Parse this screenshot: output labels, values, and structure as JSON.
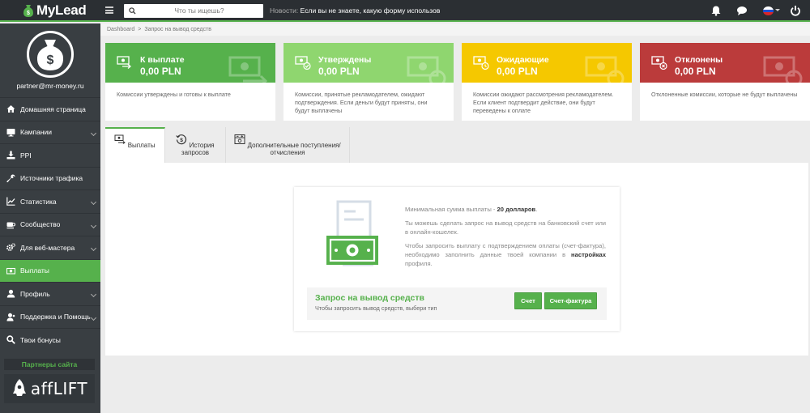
{
  "app": {
    "logo_my": "My",
    "logo_lead": "Lead"
  },
  "topbar": {
    "search_placeholder": "Что ты ищешь?",
    "news_label": "Новости:",
    "news_text": "Если вы не знаете, какую форму использовать при оп"
  },
  "sidebar": {
    "user_email": "partner@mr-money.ru",
    "items": [
      {
        "label": "Домашняя страница",
        "icon": "home-icon",
        "chevron": false
      },
      {
        "label": "Кампании",
        "icon": "monitor-icon",
        "chevron": true
      },
      {
        "label": "PPI",
        "icon": "download-icon",
        "chevron": false
      },
      {
        "label": "Источники трафика",
        "icon": "wrench-icon",
        "chevron": false
      },
      {
        "label": "Статистика",
        "icon": "chart-icon",
        "chevron": true
      },
      {
        "label": "Сообщество",
        "icon": "coffee-icon",
        "chevron": true
      },
      {
        "label": "Для веб-мастера",
        "icon": "gears-icon",
        "chevron": true
      },
      {
        "label": "Выплаты",
        "icon": "money-icon",
        "chevron": false,
        "active": true
      },
      {
        "label": "Профиль",
        "icon": "user-icon",
        "chevron": true
      },
      {
        "label": "Поддержка и Помощь",
        "icon": "user-help-icon",
        "chevron": true
      },
      {
        "label": "Твои бонусы",
        "icon": "search-icon",
        "chevron": false
      }
    ],
    "partners_label": "Партнеры сайта",
    "partner_logo_text": "affLIFT"
  },
  "breadcrumb": {
    "root": "Dashboard",
    "separator": ">",
    "current": "Запрос на вывод средств"
  },
  "cards": [
    {
      "title": "К выплате",
      "amount": "0,00 PLN",
      "desc": "Комиссии утверждены и готовы к выплате",
      "color": "#56b14c"
    },
    {
      "title": "Утверждены",
      "amount": "0,00 PLN",
      "desc": "Комиссии, принятые рекламодателем, ожидают подтверждения. Если деньги будут приняты, они будут выплачены",
      "color": "#8fd66f"
    },
    {
      "title": "Ожидающие",
      "amount": "0,00 PLN",
      "desc": "Комиссии ожидают рассмотрения рекламодателем. Если клиент подтвердит действие, они будут переведены к оплате",
      "color": "#f5c800"
    },
    {
      "title": "Отклонены",
      "amount": "0,00 PLN",
      "desc": "Отклоненные комиссии, которые не будут выплачены",
      "color": "#bb3b3b"
    }
  ],
  "tabs": [
    {
      "label": "Выплаты",
      "icon": "payout-icon",
      "active": true
    },
    {
      "label": "История запросов",
      "icon": "history-icon",
      "active": false
    },
    {
      "label": "Дополнительные поступления/отчисления",
      "icon": "adjustments-icon",
      "active": false
    }
  ],
  "payout": {
    "min_prefix": "Минимальная сумма выплаты - ",
    "min_amount": "20 долларов",
    "line2": "Ты можешь сделать запрос на вывод средств на банковский счет или в онлайн-кошелек.",
    "line3_prefix": "Чтобы запросить выплату с подтверждением оплаты (счет-фактура), необходимо заполнить данные твоей компании в ",
    "line3_link": "настройках",
    "line3_suffix": " профиля.",
    "request_title": "Запрос на вывод средств",
    "request_sub": "Чтобы запросить вывод средств, выбери тип",
    "btn_invoice": "Счет",
    "btn_vat_invoice": "Счет-фактура"
  },
  "colors": {
    "accent": "#56b14c",
    "sidebar_bg": "#393e42",
    "topbar_bg": "#2b2f33"
  }
}
